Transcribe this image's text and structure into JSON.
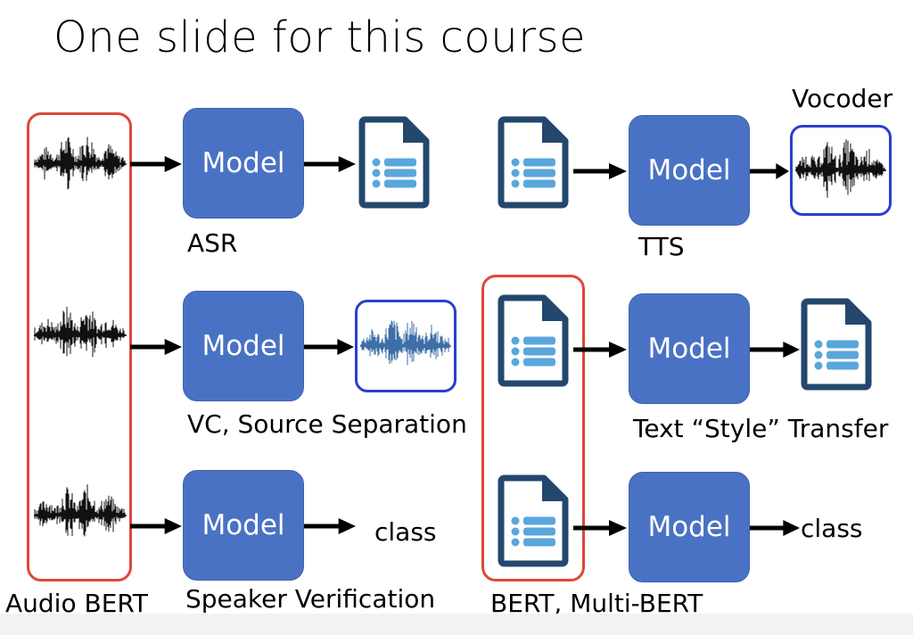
{
  "slide": {
    "title": "One slide for this course",
    "model_label": "Model",
    "labels": {
      "asr": "ASR",
      "vc": "VC, Source Separation",
      "speaker_verification": "Speaker Verification",
      "audio_bert": "Audio BERT",
      "vocoder": "Vocoder",
      "tts": "TTS",
      "text_style_transfer": "Text “Style” Transfer",
      "bert_multi_bert": "BERT, Multi-BERT",
      "class_left": "class",
      "class_right": "class"
    }
  },
  "colors": {
    "model_fill": "#4a72c4",
    "red_outline": "#e0463a",
    "blue_outline": "#2a3fd0",
    "doc_dark": "#24476e",
    "doc_light": "#5aa6dc"
  },
  "icons": [
    "waveform-icon",
    "document-icon",
    "arrow-right-icon"
  ]
}
